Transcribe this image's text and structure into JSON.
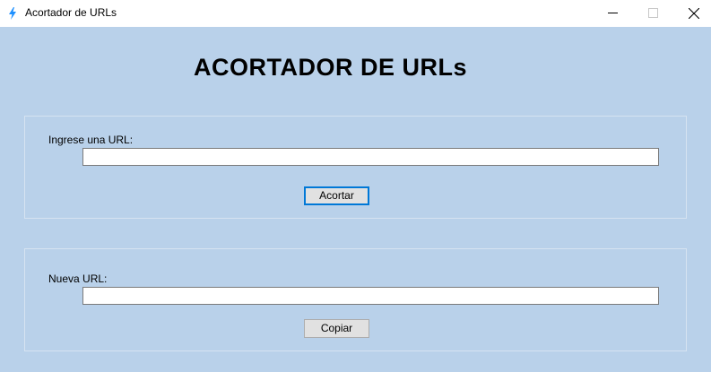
{
  "window": {
    "title": "Acortador de URLs",
    "icon": "lightning-bolt-icon",
    "controls": [
      "minimize-icon",
      "maximize-icon",
      "close-icon"
    ]
  },
  "heading": "ACORTADOR DE URLs",
  "input_section": {
    "label": "Ingrese una URL:",
    "value": "",
    "button_label": "Acortar"
  },
  "output_section": {
    "label": "Nueva URL:",
    "value": "",
    "button_label": "Copiar"
  },
  "colors": {
    "form_background": "#b9d1ea",
    "titlebar_background": "#ffffff",
    "focus_border": "#0078d7",
    "button_face": "#e1e1e1"
  }
}
